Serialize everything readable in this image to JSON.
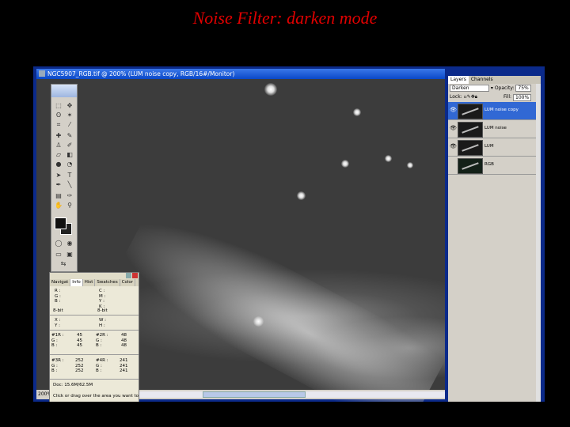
{
  "slide_title": "Noise Filter: darken mode",
  "document": {
    "title": "NGC5907_RGB.tif @ 200% (LUM  noise copy, RGB/16#/Monitor)",
    "zoom": "200%"
  },
  "info_palette": {
    "tabs": [
      "Navigat",
      "Info",
      "Hist",
      "Swatches",
      "Color"
    ],
    "active_tab": "Info",
    "rgb_labels": "R :\nG :\nB :",
    "cmyk_labels": "C :\nM :\nY :\nK :",
    "bit_left": "8-bit",
    "bit_right": "8-bit",
    "xy_labels": "X :\nY :",
    "wh_labels": "W :\nH :",
    "s1_left_labels": "#1R :\nG :\nB :",
    "s1_left_values": "45\n45\n45",
    "s1_right_labels": "#2R :\nG :\nB :",
    "s1_right_values": "48\n48\n48",
    "s2_left_labels": "#3R :\nG :\nB :",
    "s2_left_values": "252\n252\n252",
    "s2_right_labels": "#4R :\nG :\nB :",
    "s2_right_values": "241\n241\n241",
    "doc_size": "Doc: 15.6M/62.5M",
    "hint": "Click or drag over the area you want to"
  },
  "layers_palette": {
    "tabs": [
      "Layers",
      "Channels"
    ],
    "active_tab": "Layers",
    "blend_mode": "Darken",
    "opacity_label": "Opacity:",
    "opacity_value": "75%",
    "lock_label": "Lock:",
    "fill_label": "Fill:",
    "fill_value": "100%",
    "layers": [
      {
        "name": "LUM  noise copy",
        "selected": true,
        "visible": true
      },
      {
        "name": "LUM  noise",
        "selected": false,
        "visible": true
      },
      {
        "name": "LUM",
        "selected": false,
        "visible": true
      },
      {
        "name": "RGB",
        "selected": false,
        "visible": false
      }
    ]
  }
}
